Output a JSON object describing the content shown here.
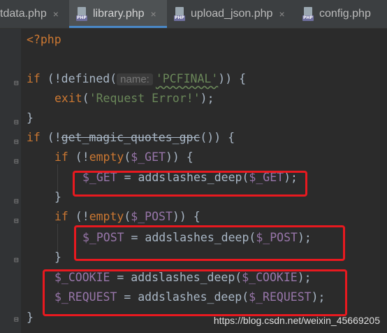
{
  "tabs": [
    {
      "label": "tdata.php"
    },
    {
      "label": "library.php",
      "badge": "PHP"
    },
    {
      "label": "upload_json.php",
      "badge": "PHP"
    },
    {
      "label": "config.php",
      "badge": "PHP"
    }
  ],
  "close_glyph": "×",
  "code": {
    "l1": "<?php",
    "l2_if": "if",
    "l2_a": " (!defined(",
    "l2_hint": "name:",
    "l2_str": "'PCFINAL'",
    "l2_b": ")) {",
    "l3_exit": "exit",
    "l3_a": "(",
    "l3_str": "'Request Error!'",
    "l3_b": ");",
    "l4": "}",
    "l5_if": "if",
    "l5_a": " (!",
    "l5_fn": "get_magic_quotes_gpc",
    "l5_b": "()) {",
    "l6_if": "if",
    "l6_a": " (!",
    "l6_fn": "empty",
    "l6_b": "(",
    "l6_var": "$_GET",
    "l6_c": ")) {",
    "l7_var1": "$_GET",
    "l7_a": " = addslashes_deep(",
    "l7_var2": "$_GET",
    "l7_b": ");",
    "l8": "}",
    "l9_if": "if",
    "l9_a": " (!",
    "l9_fn": "empty",
    "l9_b": "(",
    "l9_var": "$_POST",
    "l9_c": ")) {",
    "l10_var1": "$_POST",
    "l10_a": " = addslashes_deep(",
    "l10_var2": "$_POST",
    "l10_b": ");",
    "l11": "}",
    "l12_var1": "$_COOKIE",
    "l12_a": " = addslashes_deep(",
    "l12_var2": "$_COOKIE",
    "l12_b": ");",
    "l13_var1": "$_REQUEST",
    "l13_a": " = addslashes_deep(",
    "l13_var2": "$_REQUEST",
    "l13_b": ");",
    "l14": "}"
  },
  "watermark": "https://blog.csdn.net/weixin_45669205",
  "colors": {
    "keyword": "#cc7832",
    "string": "#6a8759",
    "variable": "#9876aa",
    "highlight_box": "#e8191f",
    "active_tab_underline": "#4a88c7"
  }
}
